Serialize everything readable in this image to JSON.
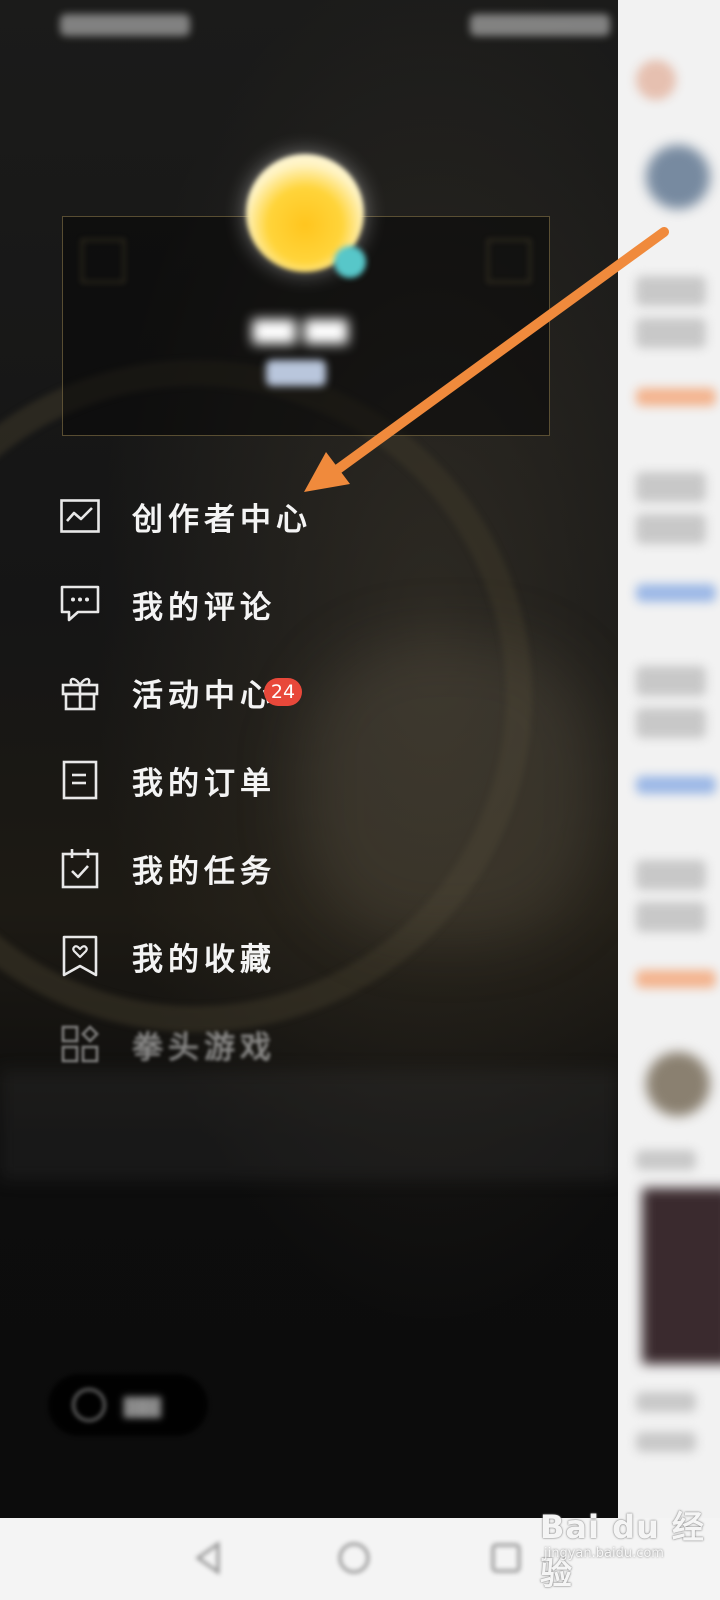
{
  "drawer": {
    "menu": [
      {
        "label": "创作者中心",
        "icon": "trend-chart-icon",
        "dim": false
      },
      {
        "label": "我的评论",
        "icon": "comment-bubble-icon",
        "dim": false
      },
      {
        "label": "活动中心",
        "icon": "gift-icon",
        "badge": "24",
        "dim": false
      },
      {
        "label": "我的订单",
        "icon": "order-document-icon",
        "dim": false
      },
      {
        "label": "我的任务",
        "icon": "task-calendar-icon",
        "dim": false
      },
      {
        "label": "我的收藏",
        "icon": "bookmark-heart-icon",
        "dim": false
      },
      {
        "label": "拳头游戏",
        "icon": "apps-grid-icon",
        "dim": true
      }
    ]
  },
  "colors": {
    "annotation_arrow": "#f08a3c",
    "badge": "#e8483a",
    "avatar": "#ffc51e"
  },
  "watermark": {
    "brand": "Bai du 经验",
    "url": "jingyan.baidu.com"
  }
}
